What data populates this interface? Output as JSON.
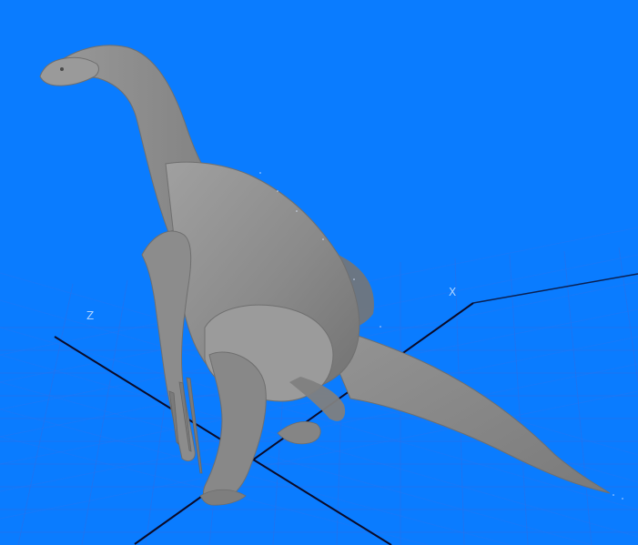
{
  "viewport": {
    "background_color": "#0a7cff",
    "grid_color": "#1b5fe0",
    "axis_color": "#0a0a28",
    "model_color": "#8d8d8d",
    "axis_labels": {
      "x": "X",
      "z": "Z"
    }
  }
}
